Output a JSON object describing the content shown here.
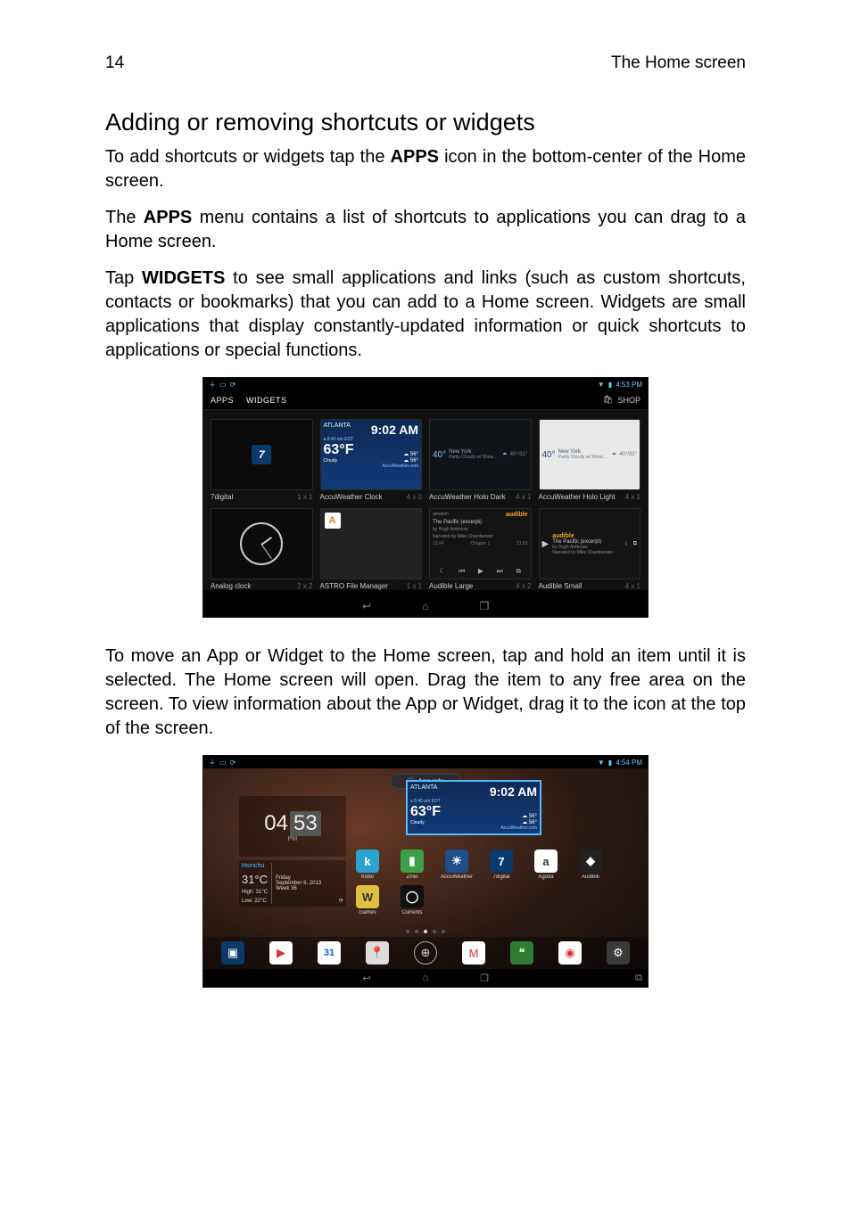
{
  "header": {
    "page_number": "14",
    "running_title": "The Home screen"
  },
  "section_title": "Adding or removing shortcuts or widgets",
  "para1_a": "To add shortcuts or widgets tap the ",
  "para1_b": "APPS",
  "para1_c": " icon in the bottom-center of the Home screen.",
  "para2_a": "The ",
  "para2_b": "APPS",
  "para2_c": " menu contains a list of shortcuts to applications you can drag to a Home screen.",
  "para3_a": "Tap ",
  "para3_b": "WIDGETS",
  "para3_c": " to see small applications and links (such as custom shortcuts, contacts or bookmarks) that you can add to a Home screen. Widgets are small applications that display constantly-updated information or quick shortcuts to applications or special functions.",
  "para4": "To move an App or Widget to the Home screen, tap and hold an item until it is selected. The Home screen will open. Drag the item to any free area on the screen. To view information about the App or Widget, drag it to the icon at the top of the screen.",
  "shot1": {
    "status_time": "4:53 PM",
    "tabs": {
      "apps": "APPS",
      "widgets": "WIDGETS"
    },
    "shop": "SHOP",
    "widgets": [
      {
        "name": "7digital",
        "size": "1 x 1"
      },
      {
        "name": "AccuWeather Clock",
        "size": "4 x 2",
        "city": "ATLANTA",
        "time": "9:02 AM",
        "temp": "63°F",
        "sub": "a 8:40 am EDT",
        "cond": "Cloudy",
        "brand": "AccuWeather.com"
      },
      {
        "name": "AccuWeather Holo Dark",
        "size": "4 x 1",
        "city": "New York",
        "temp1": "40°",
        "temphl": "40°/31°"
      },
      {
        "name": "AccuWeather Holo Light",
        "size": "4 x 1",
        "city": "New York",
        "temp1": "40°",
        "temphl": "40°/31°"
      },
      {
        "name": "Analog clock",
        "size": "2 x 2"
      },
      {
        "name": "ASTRO File Manager",
        "size": "1 x 1"
      },
      {
        "name": "Audible Large",
        "size": "4 x 2",
        "brand": "audible",
        "title": "The Pacific (excerpt)",
        "author": "by Hugh Ambrose",
        "narr": "Narrated by Mike Chamberlain",
        "chapter": "Chapter 1",
        "t1": "12:44",
        "t2": "11:52"
      },
      {
        "name": "Audible Small",
        "size": "4 x 1",
        "brand": "audible",
        "title": "The Pacific (excerpt)",
        "author": "by Hugh Ambrose",
        "narr": "Narrated by Mike Chamberlain"
      }
    ]
  },
  "shot2": {
    "status_time": "4:54 PM",
    "app_info": "App info",
    "drag_widget": {
      "city": "ATLANTA",
      "time": "9:02 AM",
      "temp": "63°F",
      "sub": "a 8:40 am EDT",
      "cond": "Cloudy",
      "brand": "AccuWeather.com"
    },
    "clock": {
      "hour": "04",
      "min": "53",
      "ampm": "PM"
    },
    "weather": {
      "city": "Hsinchu",
      "temp": "31°C",
      "high": "High: 31°C",
      "low": "Low: 22°C",
      "day": "Friday",
      "date": "September 6, 2013",
      "week": "Week 36"
    },
    "home_icons": [
      {
        "label": "Kobo",
        "bg": "#2aa3d0",
        "glyph": "k"
      },
      {
        "label": "Zinio",
        "bg": "#3aa04a",
        "glyph": "▮"
      },
      {
        "label": "AccuWeather",
        "bg": "#1d4f8b",
        "glyph": "☀"
      },
      {
        "label": "7digital",
        "bg": "#0a3a6a",
        "glyph": "7"
      },
      {
        "label": "Agoda",
        "bg": "#ffffff",
        "glyph": "a"
      },
      {
        "label": "Audible",
        "bg": "#222222",
        "glyph": "◆"
      },
      {
        "label": "Games",
        "bg": "#e0c040",
        "glyph": "W"
      },
      {
        "label": "Currents",
        "bg": "#111111",
        "glyph": "◯"
      }
    ],
    "dock": [
      {
        "name": "dolby",
        "bg": "#0b3a6a",
        "glyph": "▣"
      },
      {
        "name": "play",
        "bg": "#ffffff",
        "glyph": "▶"
      },
      {
        "name": "calendar",
        "bg": "#ffffff",
        "glyph": "31"
      },
      {
        "name": "maps",
        "bg": "#dddddd",
        "glyph": "📍"
      },
      {
        "name": "apps",
        "bg": "transparent",
        "glyph": "⊕"
      },
      {
        "name": "gmail",
        "bg": "#ffffff",
        "glyph": "M"
      },
      {
        "name": "hangouts",
        "bg": "#2e7d32",
        "glyph": "❝"
      },
      {
        "name": "chrome",
        "bg": "#ffffff",
        "glyph": "◉"
      },
      {
        "name": "settings",
        "bg": "#3a3a3a",
        "glyph": "⚙"
      }
    ]
  }
}
